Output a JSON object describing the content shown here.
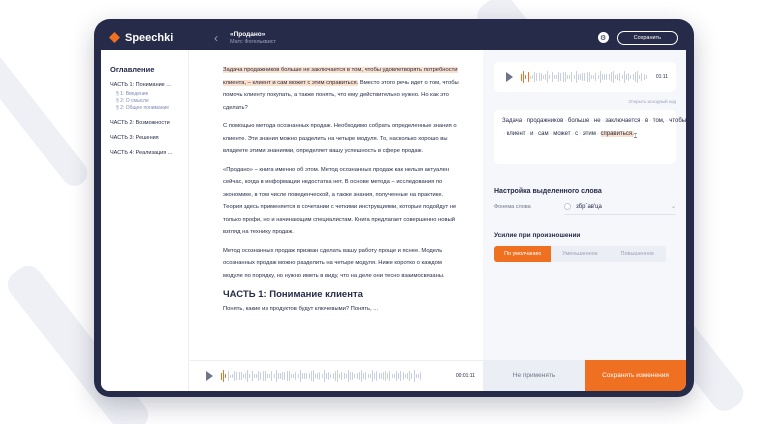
{
  "app": {
    "logo_text": "Speechki",
    "doc_title": "«Продано»",
    "doc_author": "Матс Фогельквист",
    "save_label": "Сохранить"
  },
  "sidebar": {
    "title": "Оглавление",
    "items": [
      {
        "label": "ЧАСТЬ 1: Понимание ..."
      },
      {
        "label": "§ 1: Введение"
      },
      {
        "label": "§ 2: О смысле"
      },
      {
        "label": "§ 2: Общее понимание"
      },
      {
        "label": "ЧАСТЬ 2: Возможности"
      },
      {
        "label": "ЧАСТЬ 3: Решения"
      },
      {
        "label": "ЧАСТЬ 4: Реализация ..."
      }
    ]
  },
  "main": {
    "p1_hl": "Задача продажников больше не заключается в том, чтобы удовлетворять потребности клиента, – клиент и сам может с этим справиться.",
    "p1_rest": " Вместо этого речь идет о том, чтобы помочь клиенту покупать, а также понять, что ему действительно нужно. Но как это сделать?",
    "p2": "С помощью метода осознанных продаж. Необходимо собрать определенные знания о клиенте. Эти знания можно разделить на четыре модуля. То, насколько хорошо вы владеете этими знаниями, определяет вашу успешность в сфере продаж.",
    "p3": "«Продано» – книга именно об этом. Метод осознанных продаж как нельзя актуален сейчас, когда в информации недостатка нет. В основе метода – исследования по экономике, в том числе поведенческой, а также знания, полученные на практике. Теория здесь применяется в сочетании с четкими инструкциями, которые подойдут не только профи, но и начинающим специалистам. Книга предлагает совершенно новый взгляд на технику продаж.",
    "p4": "Метод осознанных продаж призван сделать вашу работу проще и яснее. Модель осознанных продаж можно разделить на четыре модуля. Ниже коротко о каждом модуле по порядку, но нужно иметь в виду, что на деле они тесно взаимосвязаны.",
    "chapter": "ЧАСТЬ 1: Понимание клиента",
    "p5": "Понять, какие из продуктов будут ключевыми? Понять, ...",
    "player_time": "00:01:11"
  },
  "right": {
    "audio_time": "01:11",
    "open_original": "Открыть исходный код",
    "ssml_words": [
      "Задача",
      "продажников",
      "больше",
      "не",
      "заключается",
      "в",
      "том,",
      "чтобы",
      "удовлетворять",
      "потребности",
      "клиента,",
      "–",
      "клиент",
      "и",
      "сам",
      "может",
      "с",
      "этим"
    ],
    "ssml_selected": "справиться.",
    "section_title": "Настройка выделенного слова",
    "phoneme_label": "Фонема слова",
    "phoneme_value": "збр`ав'ца",
    "effort_title": "Усилие при произношении",
    "effort_options": [
      "По умолчанию",
      "Уменьшенное",
      "Повышенное"
    ],
    "cancel_label": "Не применять",
    "apply_label": "Сохранить изменения"
  },
  "colors": {
    "accent": "#f07022",
    "frame": "#252b49",
    "highlight": "#fbe0cc"
  }
}
